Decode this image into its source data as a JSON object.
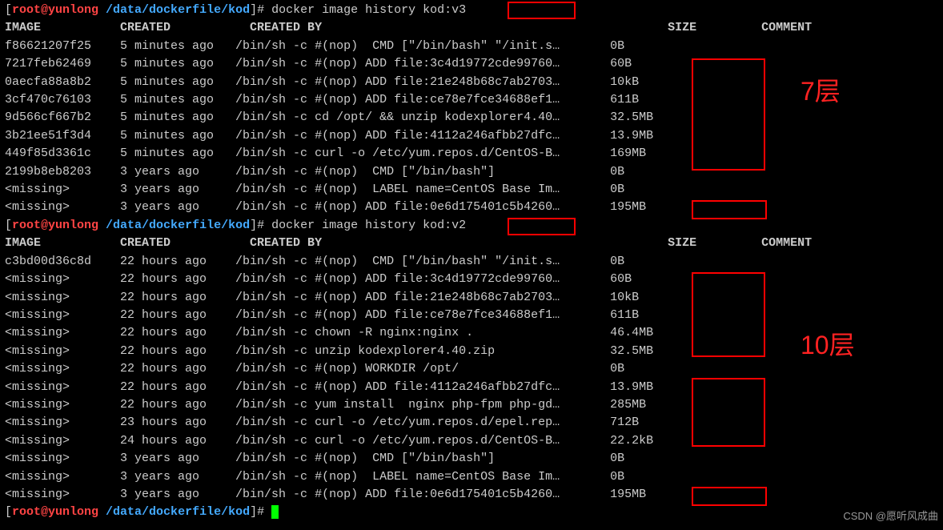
{
  "prompt": {
    "bracket_open": "[",
    "user": "root@yunlong",
    "path": " /data/dockerfile/kod",
    "bracket_close": "]",
    "hash": "# "
  },
  "cmd1": "docker image history kod:v3",
  "cmd2": "docker image history kod:v2",
  "header": {
    "image": "IMAGE",
    "created": "CREATED",
    "created_by": "CREATED BY",
    "size": "SIZE",
    "comment": "COMMENT"
  },
  "rows1": [
    {
      "image": "f86621207f25",
      "created": "5 minutes ago",
      "by": "/bin/sh -c #(nop)  CMD [\"/bin/bash\" \"/init.s…",
      "size": "0B"
    },
    {
      "image": "7217feb62469",
      "created": "5 minutes ago",
      "by": "/bin/sh -c #(nop) ADD file:3c4d19772cde99760…",
      "size": "60B"
    },
    {
      "image": "0aecfa88a8b2",
      "created": "5 minutes ago",
      "by": "/bin/sh -c #(nop) ADD file:21e248b68c7ab2703…",
      "size": "10kB"
    },
    {
      "image": "3cf470c76103",
      "created": "5 minutes ago",
      "by": "/bin/sh -c #(nop) ADD file:ce78e7fce34688ef1…",
      "size": "611B"
    },
    {
      "image": "9d566cf667b2",
      "created": "5 minutes ago",
      "by": "/bin/sh -c cd /opt/ && unzip kodexplorer4.40…",
      "size": "32.5MB"
    },
    {
      "image": "3b21ee51f3d4",
      "created": "5 minutes ago",
      "by": "/bin/sh -c #(nop) ADD file:4112a246afbb27dfc…",
      "size": "13.9MB"
    },
    {
      "image": "449f85d3361c",
      "created": "5 minutes ago",
      "by": "/bin/sh -c curl -o /etc/yum.repos.d/CentOS-B…",
      "size": "169MB"
    },
    {
      "image": "2199b8eb8203",
      "created": "3 years ago",
      "by": "/bin/sh -c #(nop)  CMD [\"/bin/bash\"]",
      "size": "0B"
    },
    {
      "image": "<missing>",
      "created": "3 years ago",
      "by": "/bin/sh -c #(nop)  LABEL name=CentOS Base Im…",
      "size": "0B"
    },
    {
      "image": "<missing>",
      "created": "3 years ago",
      "by": "/bin/sh -c #(nop) ADD file:0e6d175401c5b4260…",
      "size": "195MB"
    }
  ],
  "rows2": [
    {
      "image": "c3bd00d36c8d",
      "created": "22 hours ago",
      "by": "/bin/sh -c #(nop)  CMD [\"/bin/bash\" \"/init.s…",
      "size": "0B"
    },
    {
      "image": "<missing>",
      "created": "22 hours ago",
      "by": "/bin/sh -c #(nop) ADD file:3c4d19772cde99760…",
      "size": "60B"
    },
    {
      "image": "<missing>",
      "created": "22 hours ago",
      "by": "/bin/sh -c #(nop) ADD file:21e248b68c7ab2703…",
      "size": "10kB"
    },
    {
      "image": "<missing>",
      "created": "22 hours ago",
      "by": "/bin/sh -c #(nop) ADD file:ce78e7fce34688ef1…",
      "size": "611B"
    },
    {
      "image": "<missing>",
      "created": "22 hours ago",
      "by": "/bin/sh -c chown -R nginx:nginx .",
      "size": "46.4MB"
    },
    {
      "image": "<missing>",
      "created": "22 hours ago",
      "by": "/bin/sh -c unzip kodexplorer4.40.zip",
      "size": "32.5MB"
    },
    {
      "image": "<missing>",
      "created": "22 hours ago",
      "by": "/bin/sh -c #(nop) WORKDIR /opt/",
      "size": "0B"
    },
    {
      "image": "<missing>",
      "created": "22 hours ago",
      "by": "/bin/sh -c #(nop) ADD file:4112a246afbb27dfc…",
      "size": "13.9MB"
    },
    {
      "image": "<missing>",
      "created": "22 hours ago",
      "by": "/bin/sh -c yum install  nginx php-fpm php-gd…",
      "size": "285MB"
    },
    {
      "image": "<missing>",
      "created": "23 hours ago",
      "by": "/bin/sh -c curl -o /etc/yum.repos.d/epel.rep…",
      "size": "712B"
    },
    {
      "image": "<missing>",
      "created": "24 hours ago",
      "by": "/bin/sh -c curl -o /etc/yum.repos.d/CentOS-B…",
      "size": "22.2kB"
    },
    {
      "image": "<missing>",
      "created": "3 years ago",
      "by": "/bin/sh -c #(nop)  CMD [\"/bin/bash\"]",
      "size": "0B"
    },
    {
      "image": "<missing>",
      "created": "3 years ago",
      "by": "/bin/sh -c #(nop)  LABEL name=CentOS Base Im…",
      "size": "0B"
    },
    {
      "image": "<missing>",
      "created": "3 years ago",
      "by": "/bin/sh -c #(nop) ADD file:0e6d175401c5b4260…",
      "size": "195MB"
    }
  ],
  "annot1": "7层",
  "annot2": "10层",
  "watermark": "CSDN @愿听风成曲"
}
